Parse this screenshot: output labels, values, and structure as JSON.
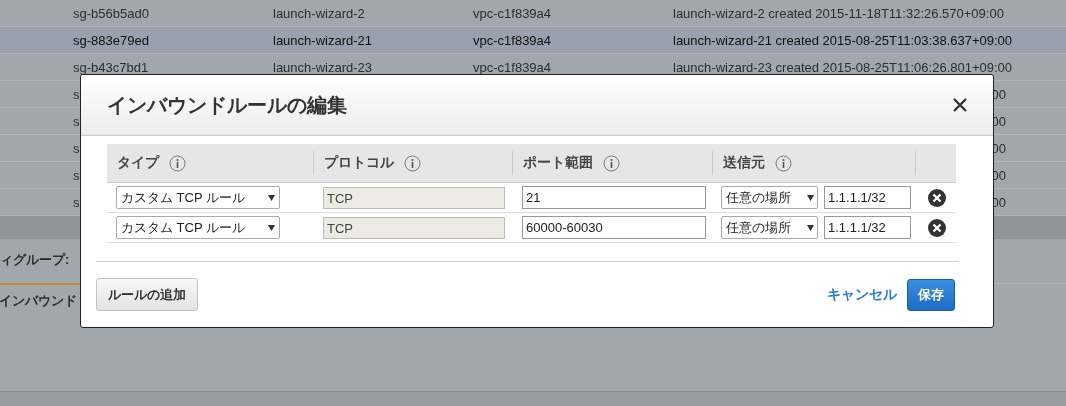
{
  "background_table": {
    "rows": [
      {
        "group_id": "sg-b56b5ad0",
        "group_name": "launch-wizard-2",
        "vpc_id": "vpc-c1f839a4",
        "description": "launch-wizard-2 created 2015-11-18T11:32:26.570+09:00",
        "selected": false
      },
      {
        "group_id": "sg-883e79ed",
        "group_name": "launch-wizard-21",
        "vpc_id": "vpc-c1f839a4",
        "description": "launch-wizard-21 created 2015-08-25T11:03:38.637+09:00",
        "selected": true
      },
      {
        "group_id": "sg-b43c7bd1",
        "group_name": "launch-wizard-23",
        "vpc_id": "vpc-c1f839a4",
        "description": "launch-wizard-23 created 2015-08-25T11:06:26.801+09:00",
        "selected": false
      },
      {
        "group_id": "s",
        "description": "00",
        "selected": false
      },
      {
        "group_id": "s",
        "description": "00",
        "selected": false
      },
      {
        "group_id": "s",
        "description": "00",
        "selected": false
      },
      {
        "group_id": "s",
        "description": "00",
        "selected": false
      },
      {
        "group_id": "s",
        "description": "00",
        "selected": false
      }
    ]
  },
  "background_panel": {
    "title": "ィグループ:",
    "tabs": [
      {
        "label": "インバウンド",
        "selected": true
      }
    ]
  },
  "dialog": {
    "title": "インバウンドルールの編集",
    "columns": [
      {
        "label": "タイプ"
      },
      {
        "label": "プロトコル"
      },
      {
        "label": "ポート範囲"
      },
      {
        "label": "送信元"
      }
    ],
    "rules": [
      {
        "type": "カスタム TCP ルール",
        "protocol": "TCP",
        "port_range": "21",
        "source": "任意の場所",
        "cidr": "1.1.1.1/32"
      },
      {
        "type": "カスタム TCP ルール",
        "protocol": "TCP",
        "port_range": "60000-60030",
        "source": "任意の場所",
        "cidr": "1.1.1.1/32"
      }
    ],
    "add_button": "ルールの追加",
    "cancel": "キャンセル",
    "save": "保存"
  }
}
